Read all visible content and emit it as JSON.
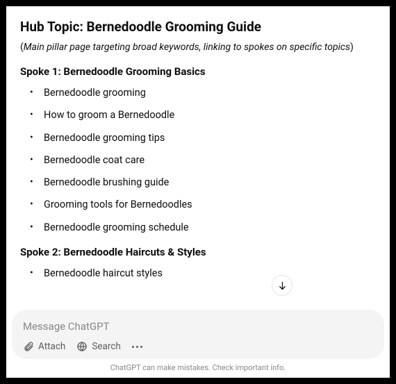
{
  "hub": {
    "title": "Hub Topic: Bernedoodle Grooming Guide",
    "subtitle": "Main pillar page targeting broad keywords, linking to spokes on specific topics"
  },
  "spokes": [
    {
      "heading": "Spoke 1: Bernedoodle Grooming Basics",
      "items": [
        "Bernedoodle grooming",
        "How to groom a Bernedoodle",
        "Bernedoodle grooming tips",
        "Bernedoodle coat care",
        "Bernedoodle brushing guide",
        "Grooming tools for Bernedoodles",
        "Bernedoodle grooming schedule"
      ]
    },
    {
      "heading": "Spoke 2: Bernedoodle Haircuts & Styles",
      "items": [
        "Bernedoodle haircut styles"
      ]
    }
  ],
  "composer": {
    "placeholder": "Message ChatGPT",
    "attach_label": "Attach",
    "search_label": "Search"
  },
  "disclaimer": "ChatGPT can make mistakes. Check important info.",
  "icons": {
    "scroll_down": "arrow-down-icon",
    "attach": "paperclip-icon",
    "search": "globe-icon",
    "more": "more-dots-icon"
  }
}
